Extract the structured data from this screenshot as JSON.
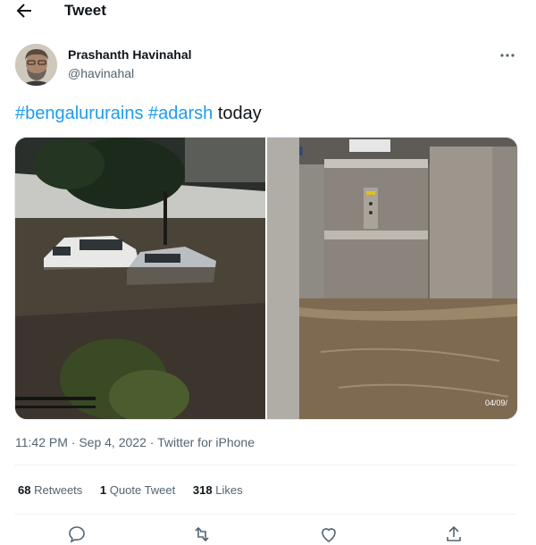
{
  "header": {
    "title": "Tweet",
    "back_icon": "back-arrow-icon"
  },
  "tweet": {
    "author": {
      "name": "Prashanth Havinahal",
      "handle": "@havinahal"
    },
    "hashtags": [
      "#bengalururains",
      "#adarsh"
    ],
    "text_suffix": " today",
    "media": {
      "left_description": "flooded street with partially submerged cars",
      "right_description": "flooded elevator lobby",
      "right_badge": "04/09/"
    },
    "time": "11:42 PM",
    "date": "Sep 4, 2022",
    "source": "Twitter for iPhone",
    "meta_sep": " · "
  },
  "stats": {
    "retweets_count": "68",
    "retweets_label": "Retweets",
    "quotes_count": "1",
    "quotes_label": "Quote Tweet",
    "likes_count": "318",
    "likes_label": "Likes"
  },
  "actions": [
    "reply-icon",
    "retweet-icon",
    "like-icon",
    "share-icon"
  ],
  "colors": {
    "link": "#1d9bf0",
    "secondary_text": "#536471",
    "primary_text": "#0f1419"
  }
}
